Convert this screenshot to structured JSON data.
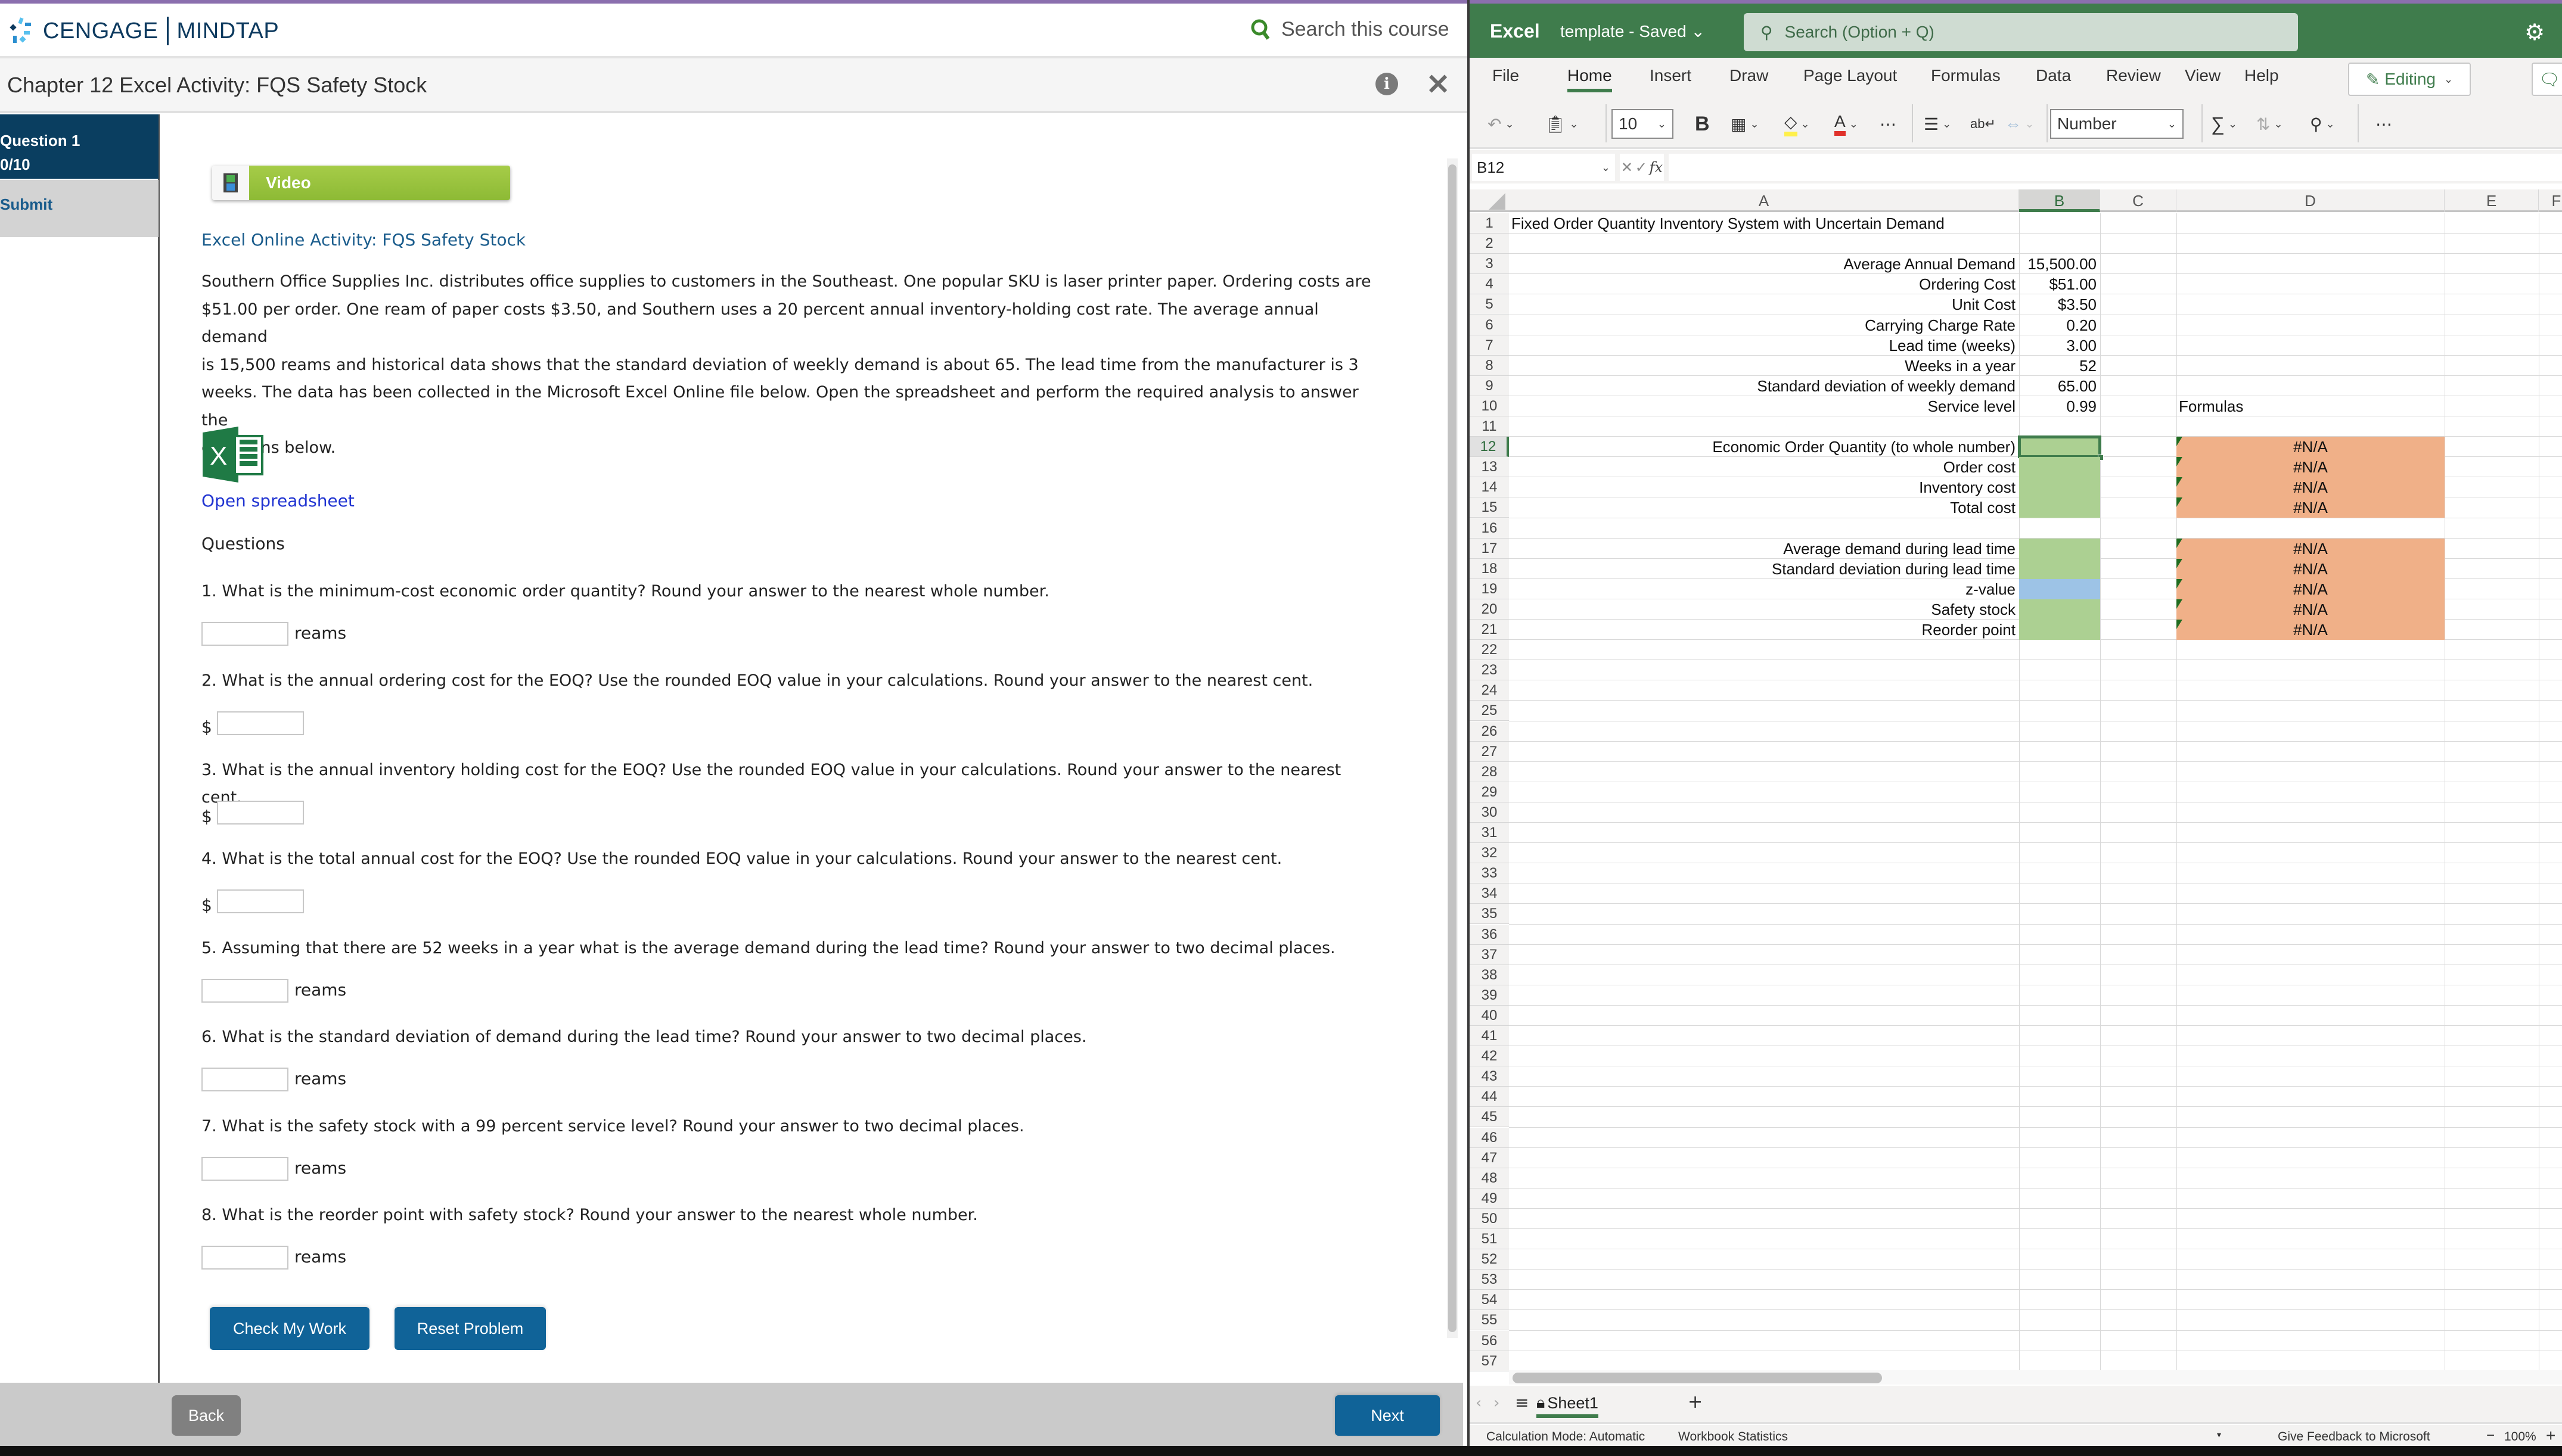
{
  "mindtap": {
    "brand_left": "CENGAGE",
    "brand_right": "MINDTAP",
    "search_label": "Search this course",
    "chapter_title": "Chapter 12 Excel Activity: FQS Safety Stock",
    "info_icon": "i",
    "close_icon": "✕",
    "sidebar": {
      "question_label": "Question 1",
      "score": "0/10",
      "submit_label": "Submit"
    },
    "video_label": "Video",
    "activity_title": "Excel Online Activity: FQS Safety Stock",
    "intro_lines": [
      "Southern Office Supplies Inc. distributes office supplies to customers in the Southeast. One popular SKU is laser printer paper. Ordering costs are",
      "$51.00 per order. One ream of paper costs $3.50, and Southern uses a 20 percent annual inventory-holding cost rate. The average annual demand",
      "is 15,500 reams and historical data shows that the standard deviation of weekly demand is about 65. The lead time from the manufacturer is 3",
      "weeks. The data has been collected in the Microsoft Excel Online file below. Open the spreadsheet and perform the required analysis to answer the",
      "questions below."
    ],
    "open_spreadsheet_label": "Open spreadsheet",
    "questions_heading": "Questions",
    "questions": [
      {
        "text": "1. What is the minimum-cost economic order quantity? Round your answer to the nearest whole number.",
        "prefix": "",
        "unit": "reams",
        "value": ""
      },
      {
        "text": "2. What is the annual ordering cost for the EOQ? Use the rounded EOQ value in your calculations. Round your answer to the nearest cent.",
        "prefix": "$",
        "unit": "",
        "value": ""
      },
      {
        "text": "3. What is the annual inventory holding cost for the EOQ? Use the rounded EOQ value in your calculations. Round your answer to the nearest cent.",
        "prefix": "$",
        "unit": "",
        "value": ""
      },
      {
        "text": "4. What is the total annual cost for the EOQ? Use the rounded EOQ value in your calculations. Round your answer to the nearest cent.",
        "prefix": "$",
        "unit": "",
        "value": ""
      },
      {
        "text": "5. Assuming that there are 52 weeks in a year what is the average demand during the lead time? Round your answer to two decimal places.",
        "prefix": "",
        "unit": "reams",
        "value": ""
      },
      {
        "text": "6. What is the standard deviation of demand during the lead time? Round your answer to two decimal places.",
        "prefix": "",
        "unit": "reams",
        "value": ""
      },
      {
        "text": "7. What is the safety stock with a 99 percent service level? Round your answer to two decimal places.",
        "prefix": "",
        "unit": "reams",
        "value": ""
      },
      {
        "text": "8. What is the reorder point with safety stock? Round your answer to the nearest whole number.",
        "prefix": "",
        "unit": "reams",
        "value": ""
      }
    ],
    "check_label": "Check My Work",
    "reset_label": "Reset Problem",
    "back_label": "Back",
    "next_label": "Next"
  },
  "excel": {
    "app_name": "Excel",
    "file_status": "template  -  Saved ⌄",
    "search_placeholder": "Search (Option + Q)",
    "tabs": [
      "File",
      "Home",
      "Insert",
      "Draw",
      "Page Layout",
      "Formulas",
      "Data",
      "Review",
      "View",
      "Help"
    ],
    "active_tab": "Home",
    "editing_label": "Editing",
    "font_size": "10",
    "number_format": "Number",
    "name_box": "B12",
    "formula": "",
    "columns": [
      "A",
      "B",
      "C",
      "D",
      "E",
      "F"
    ],
    "selected_column": "B",
    "selected_row": 12,
    "rows": [
      {
        "row": 1,
        "A": "Fixed Order Quantity Inventory System with Uncertain Demand",
        "B": "",
        "D": ""
      },
      {
        "row": 3,
        "A": "Average Annual Demand",
        "B": "15,500.00"
      },
      {
        "row": 4,
        "A": "Ordering Cost",
        "B": "$51.00"
      },
      {
        "row": 5,
        "A": "Unit Cost",
        "B": "$3.50"
      },
      {
        "row": 6,
        "A": "Carrying Charge Rate",
        "B": "0.20"
      },
      {
        "row": 7,
        "A": "Lead time (weeks)",
        "B": "3.00"
      },
      {
        "row": 8,
        "A": "Weeks in a year",
        "B": "52"
      },
      {
        "row": 9,
        "A": "Standard deviation of weekly demand",
        "B": "65.00"
      },
      {
        "row": 10,
        "A": "Service level",
        "B": "0.99",
        "D": "Formulas"
      },
      {
        "row": 12,
        "A": "Economic Order Quantity (to whole number)",
        "B": "",
        "D": "#N/A",
        "fill": "green"
      },
      {
        "row": 13,
        "A": "Order cost",
        "B": "",
        "D": "#N/A",
        "fill": "green"
      },
      {
        "row": 14,
        "A": "Inventory cost",
        "B": "",
        "D": "#N/A",
        "fill": "green"
      },
      {
        "row": 15,
        "A": "Total cost",
        "B": "",
        "D": "#N/A",
        "fill": "green"
      },
      {
        "row": 17,
        "A": "Average demand during lead time",
        "B": "",
        "D": "#N/A",
        "fill": "green"
      },
      {
        "row": 18,
        "A": "Standard deviation during lead time",
        "B": "",
        "D": "#N/A",
        "fill": "green"
      },
      {
        "row": 19,
        "A": "z-value",
        "B": "",
        "D": "#N/A",
        "fill": "blue"
      },
      {
        "row": 20,
        "A": "Safety stock",
        "B": "",
        "D": "#N/A",
        "fill": "green"
      },
      {
        "row": 21,
        "A": "Reorder point",
        "B": "",
        "D": "#N/A",
        "fill": "green"
      }
    ],
    "row_count": 57,
    "sheet_tab": "Sheet1",
    "status_left": [
      "Calculation Mode: Automatic",
      "Workbook Statistics"
    ],
    "feedback_label": "Give Feedback to Microsoft",
    "zoom_level": "100%"
  },
  "colors": {
    "excel_green": "#3f7c4c",
    "mindtap_navy": "#0a3e60",
    "button_blue": "#106398",
    "input_cell_green": "#acd092",
    "zvalue_cell_blue": "#9dc3e6",
    "formula_cell_orange": "#f0b088"
  }
}
